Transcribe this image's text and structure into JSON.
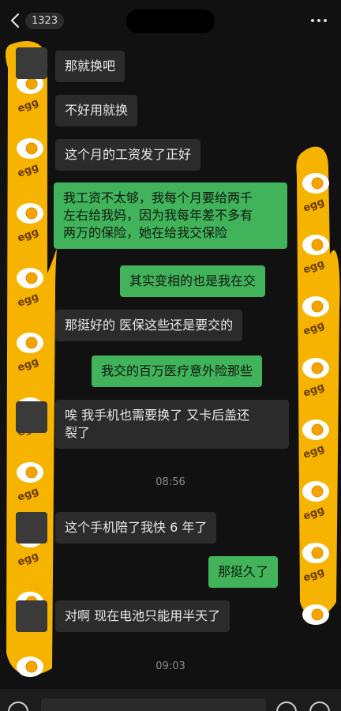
{
  "header": {
    "back_badge": "1323",
    "more_label": "···"
  },
  "messages": [
    {
      "id": "m1",
      "side": "in",
      "text": "那就换吧"
    },
    {
      "id": "m2",
      "side": "in",
      "text": "不好用就换"
    },
    {
      "id": "m3",
      "side": "in",
      "text": "这个月的工资发了正好"
    },
    {
      "id": "m4",
      "side": "out",
      "text": "我工资不太够，我每个月要给两千\n左右给我妈，因为我每年差不多有\n两万的保险，她在给我交保险"
    },
    {
      "id": "m5",
      "side": "out",
      "text": "其实变相的也是我在交"
    },
    {
      "id": "m6",
      "side": "in",
      "text": "那挺好的 医保这些还是要交的"
    },
    {
      "id": "m7",
      "side": "out",
      "text": "我交的百万医疗意外险那些"
    },
    {
      "id": "m8",
      "side": "in",
      "text": "唉 我手机也需要换了 又卡后盖还\n裂了"
    },
    {
      "id": "m9",
      "side": "in",
      "text": "这个手机陪了我快 6 年了"
    },
    {
      "id": "m10",
      "side": "out",
      "text": "那挺久了"
    },
    {
      "id": "m11",
      "side": "in",
      "text": "对啊 现在电池只能用半天了"
    }
  ],
  "timestamps": {
    "t1": "08:56",
    "t2": "09:03"
  },
  "sticker_text": "egg",
  "colors": {
    "background": "#111111",
    "incoming_bubble": "#2b2b2b",
    "outgoing_bubble": "#41b35a",
    "censor_yellow": "#f6b300"
  },
  "icons": {
    "back": "chevron-left-icon",
    "more": "more-dots-icon",
    "voice": "voice-icon",
    "emoji": "emoji-icon",
    "plus": "plus-icon"
  }
}
